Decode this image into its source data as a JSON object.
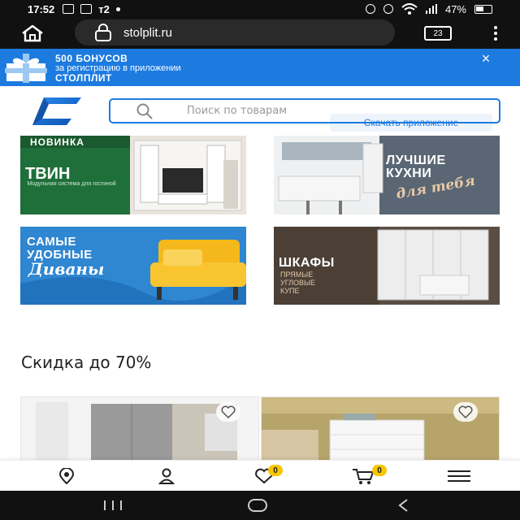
{
  "status_bar": {
    "time": "17:52",
    "carrier": "т2",
    "battery": "47%"
  },
  "browser": {
    "url": "stolplit.ru",
    "tab_count": "23"
  },
  "promo_banner": {
    "title": "500 БОНУСОВ",
    "subtitle": "за регистрацию в приложении",
    "brand": "СТОЛПЛИТ",
    "download_label": "Скачать приложение",
    "close_label": "×"
  },
  "search": {
    "placeholder": "Поиск по товарам"
  },
  "tiles": {
    "tvin": {
      "badge": "НОВИНКА",
      "title": "ТВИН",
      "caption": "Модульная система для гостиной"
    },
    "kitchens": {
      "line1": "ЛУЧШИЕ",
      "line2": "КУХНИ",
      "line3": "для тебя"
    },
    "sofas": {
      "line1": "САМЫЕ",
      "line2": "УДОБНЫЕ",
      "line3": "Диваны"
    },
    "wardrobes": {
      "title": "ШКАФЫ",
      "line1": "ПРЯМЫЕ",
      "line2": "УГЛОВЫЕ",
      "line3": "КУПЕ"
    }
  },
  "discount": {
    "title": "Скидка до 70%"
  },
  "bottom_nav": {
    "favorites_count": "0",
    "cart_count": "0"
  },
  "colors": {
    "accent": "#1d7be0",
    "badge": "#f7c600"
  },
  "icons": [
    "home-icon",
    "lock-icon",
    "tabs-icon",
    "overflow-menu-icon",
    "gift-icon",
    "close-icon",
    "search-icon",
    "heart-icon",
    "location-icon",
    "profile-icon",
    "cart-icon",
    "hamburger-icon"
  ]
}
